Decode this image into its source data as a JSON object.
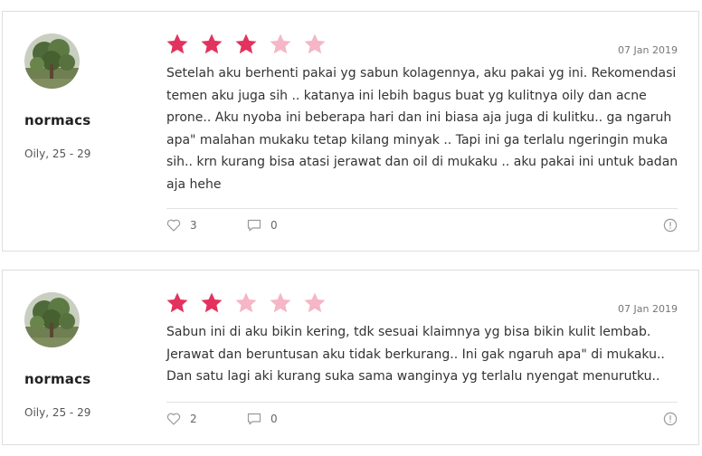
{
  "colors": {
    "star_filled": "#e2325d",
    "star_empty": "#f5b6c7",
    "border": "#dedede"
  },
  "reviews": [
    {
      "user": {
        "name": "normacs",
        "meta": "Oily, 25 - 29",
        "avatar_icon": "tree-photo-avatar"
      },
      "rating": 3,
      "max_rating": 5,
      "date": "07 Jan 2019",
      "text": "Setelah aku berhenti pakai yg sabun kolagennya, aku pakai yg ini. Rekomendasi temen aku juga sih .. katanya ini lebih bagus buat yg kulitnya oily dan acne prone.. Aku nyoba ini beberapa hari dan ini biasa aja juga di kulitku.. ga ngaruh apa\" malahan mukaku tetap kilang minyak .. Tapi ini ga terlalu ngeringin muka sih.. krn kurang bisa atasi jerawat dan oil di mukaku .. aku pakai ini untuk badan aja hehe",
      "likes": "3",
      "comments": "0"
    },
    {
      "user": {
        "name": "normacs",
        "meta": "Oily, 25 - 29",
        "avatar_icon": "tree-photo-avatar"
      },
      "rating": 2,
      "max_rating": 5,
      "date": "07 Jan 2019",
      "text": "Sabun ini di aku bikin kering, tdk sesuai klaimnya yg bisa bikin kulit lembab. Jerawat dan beruntusan aku tidak berkurang.. Ini gak ngaruh apa\" di mukaku.. Dan satu lagi aki kurang suka sama wanginya yg terlalu nyengat menurutku..",
      "likes": "2",
      "comments": "0"
    }
  ]
}
